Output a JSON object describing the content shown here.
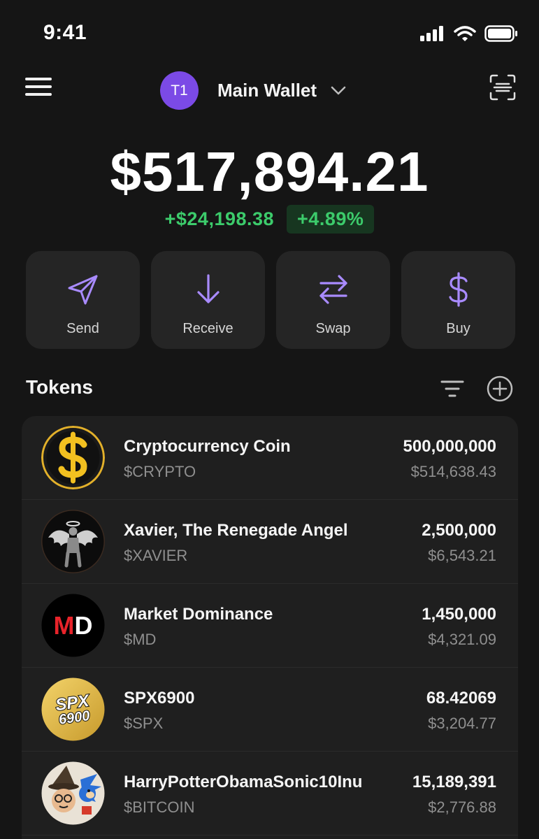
{
  "status_bar": {
    "time": "9:41"
  },
  "header": {
    "wallet_avatar_text": "T1",
    "wallet_name": "Main Wallet",
    "menu_icon": "hamburger-menu-icon",
    "scan_icon": "scan-icon"
  },
  "balance": {
    "total": "$517,894.21",
    "change_amount": "+$24,198.38",
    "change_percent": "+4.89%"
  },
  "actions": [
    {
      "label": "Send",
      "icon": "send-icon"
    },
    {
      "label": "Receive",
      "icon": "arrow-down-icon"
    },
    {
      "label": "Swap",
      "icon": "swap-icon"
    },
    {
      "label": "Buy",
      "icon": "dollar-icon"
    }
  ],
  "tokens": {
    "title": "Tokens",
    "items": [
      {
        "name": "Cryptocurrency Coin",
        "symbol": "$CRYPTO",
        "amount": "500,000,000",
        "value": "$514,638.43"
      },
      {
        "name": "Xavier, The Renegade Angel",
        "symbol": "$XAVIER",
        "amount": "2,500,000",
        "value": "$6,543.21"
      },
      {
        "name": "Market Dominance",
        "symbol": "$MD",
        "amount": "1,450,000",
        "value": "$4,321.09",
        "logo_text": "MD"
      },
      {
        "name": "SPX6900",
        "symbol": "$SPX",
        "amount": "68.42069",
        "value": "$3,204.77",
        "logo_text_top": "SPX",
        "logo_text_bottom": "6900"
      },
      {
        "name": "HarryPotterObamaSonic10Inu",
        "symbol": "$BITCOIN",
        "amount": "15,189,391",
        "value": "$2,776.88"
      }
    ]
  },
  "colors": {
    "background": "#151515",
    "card": "#252525",
    "accent_purple": "#a98bff",
    "positive_green": "#3ccb6b",
    "muted_text": "#8f8f8f"
  }
}
